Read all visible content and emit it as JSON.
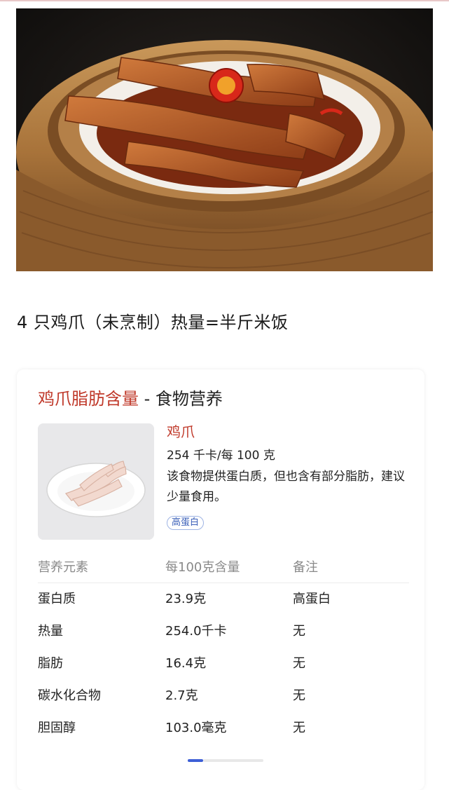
{
  "headline": "4 只鸡爪（未烹制）热量=半斤米饭",
  "card": {
    "title_link": "鸡爪脂肪含量",
    "title_sep": " - ",
    "title_rest": "食物营养",
    "food_name": "鸡爪",
    "kcal": "254 千卡/每 100 克",
    "description": "该食物提供蛋白质，但也含有部分脂肪，建议少量食用。",
    "tag": "高蛋白",
    "table": {
      "headers": [
        "营养元素",
        "每100克含量",
        "备注"
      ],
      "rows": [
        [
          "蛋白质",
          "23.9克",
          "高蛋白"
        ],
        [
          "热量",
          "254.0千卡",
          "无"
        ],
        [
          "脂肪",
          "16.4克",
          "无"
        ],
        [
          "碳水化合物",
          "2.7克",
          "无"
        ],
        [
          "胆固醇",
          "103.0毫克",
          "无"
        ]
      ]
    },
    "pager": {
      "pages": 3,
      "active": 1
    }
  },
  "colors": {
    "accent_red": "#c03a2b",
    "tag_blue": "#3a5fb8",
    "pager_blue": "#3d5fd6"
  }
}
